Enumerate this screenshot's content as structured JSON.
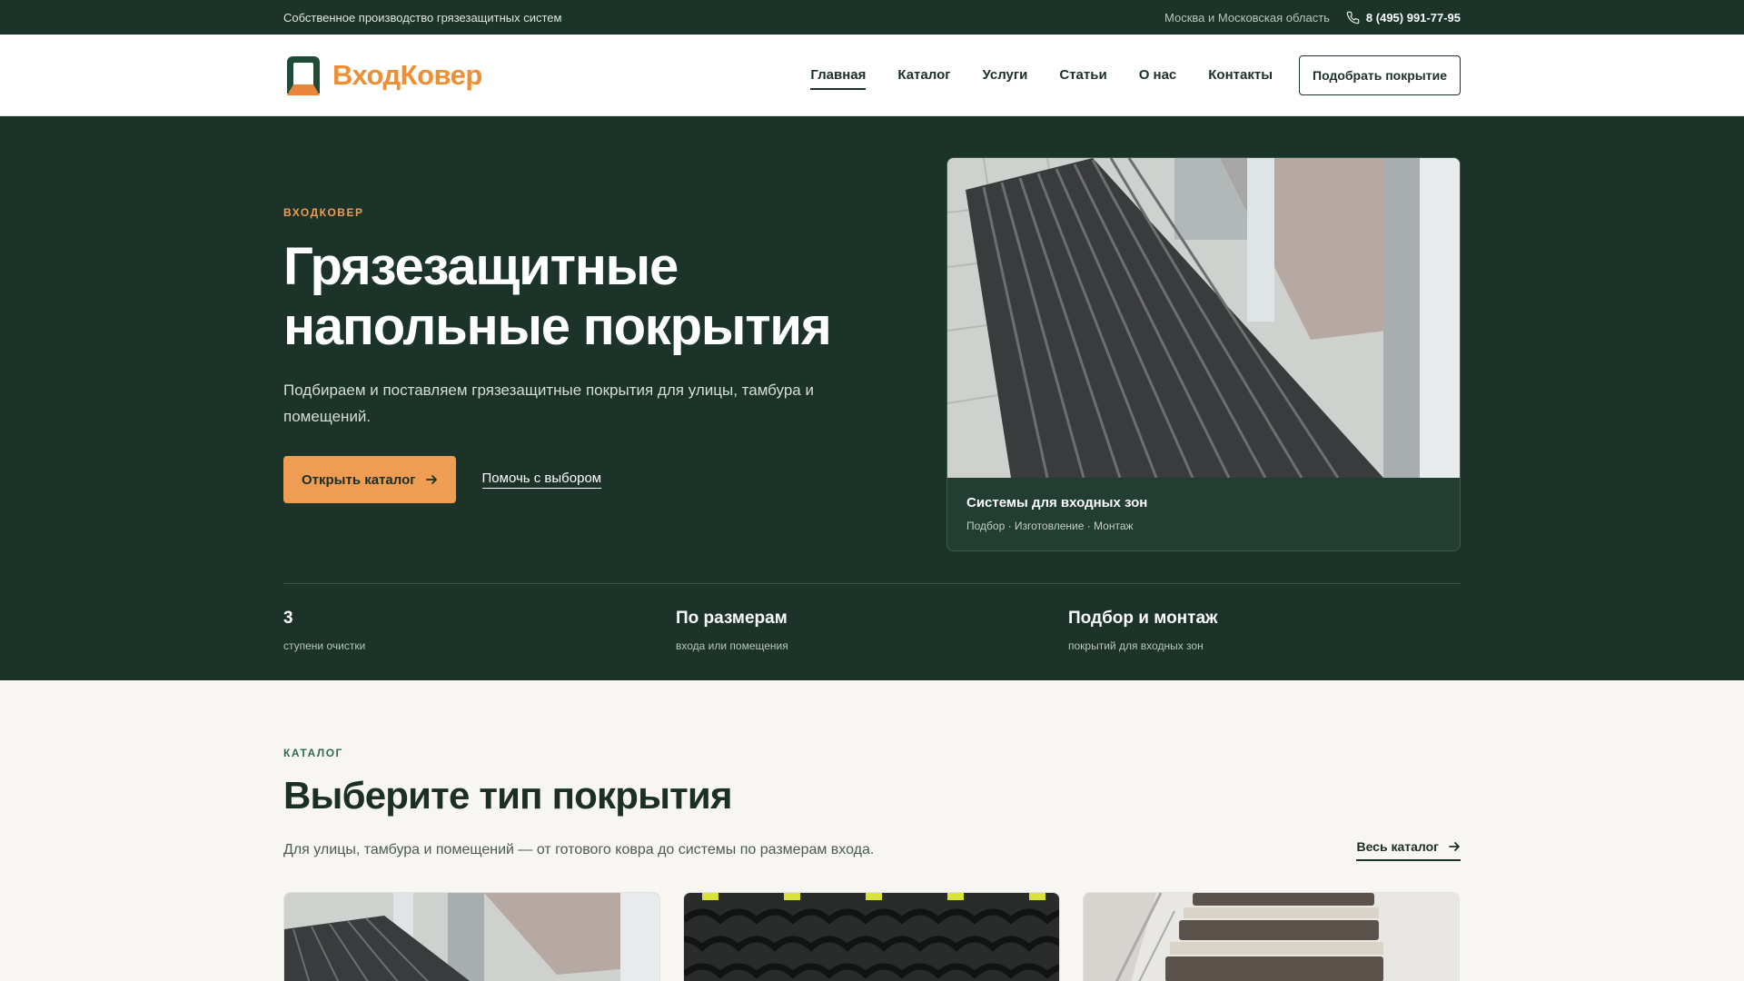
{
  "topbar": {
    "tagline": "Собственное производство грязезащитных систем",
    "region": "Москва и Московская область",
    "phone": "8 (495) 991-77-95"
  },
  "header": {
    "logo_text": "ВходКовер",
    "nav": [
      {
        "label": "Главная",
        "active": true
      },
      {
        "label": "Каталог"
      },
      {
        "label": "Услуги"
      },
      {
        "label": "Статьи"
      },
      {
        "label": "О нас"
      },
      {
        "label": "Контакты"
      }
    ],
    "cta_label": "Подобрать покрытие"
  },
  "hero": {
    "eyebrow": "ВХОДКОВЕР",
    "title_line1": "Грязезащитные",
    "title_line2": "напольные покрытия",
    "subtitle": "Подбираем и поставляем грязезащитные покрытия для улицы, тамбура и помещений.",
    "primary_button": "Открыть каталог",
    "secondary_link": "Помочь с выбором",
    "card": {
      "title": "Системы для входных зон",
      "subtitle": "Подбор · Изготовление · Монтаж"
    },
    "stats": [
      {
        "value": "3",
        "label": "ступени очистки"
      },
      {
        "value": "По размерам",
        "label": "входа или помещения"
      },
      {
        "value": "Подбор и монтаж",
        "label": "покрытий для входных зон"
      }
    ]
  },
  "catalog": {
    "eyebrow": "КАТАЛОГ",
    "title": "Выберите тип покрытия",
    "subtitle": "Для улицы, тамбура и помещений — от готового ковра до системы по размерам входа.",
    "all_link": "Весь каталог"
  },
  "colors": {
    "dark_green": "#1b3328",
    "accent_orange": "#ee9d52",
    "page_bg": "#f7f6f3"
  }
}
